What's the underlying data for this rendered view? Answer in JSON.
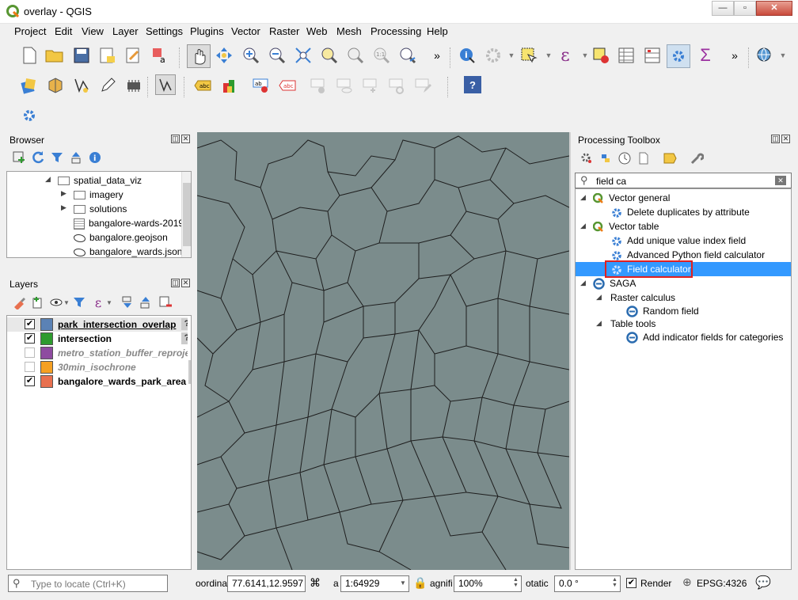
{
  "window": {
    "title": "overlay - QGIS",
    "min": "—",
    "max": "▫",
    "close": "✕"
  },
  "menus": [
    "Project",
    "Edit",
    "View",
    "Layer",
    "Settings",
    "Plugins",
    "Vector",
    "Raster",
    "Web",
    "Mesh",
    "Processing",
    "Help"
  ],
  "toolbar": {
    "more1": "»",
    "more2": "»",
    "help_icon": "?"
  },
  "browser": {
    "title": "Browser",
    "items": [
      {
        "label": "spatial_data_viz",
        "type": "folder"
      },
      {
        "label": "imagery",
        "type": "folder"
      },
      {
        "label": "solutions",
        "type": "folder"
      },
      {
        "label": "bangalore-wards-2019",
        "type": "file"
      },
      {
        "label": "bangalore.geojson",
        "type": "poly"
      },
      {
        "label": "bangalore_wards.json",
        "type": "poly"
      }
    ]
  },
  "layers": {
    "title": "Layers",
    "items": [
      {
        "name": "park_intersection_overlap",
        "color": "#5b82b5",
        "checked": true,
        "style": "bold-underline",
        "warn": "?"
      },
      {
        "name": "intersection",
        "color": "#2e9b2e",
        "checked": true,
        "style": "bold",
        "warn": "?"
      },
      {
        "name": "metro_station_buffer_reproje",
        "color": "#8e4ba0",
        "checked": false,
        "style": "italic"
      },
      {
        "name": "30min_isochrone",
        "color": "#f5a023",
        "checked": false,
        "style": "italic"
      },
      {
        "name": "bangalore_wards_park_area",
        "color": "#e8704f",
        "checked": true,
        "style": "bold"
      }
    ]
  },
  "toolbox": {
    "title": "Processing Toolbox",
    "search_value": "field ca",
    "tree": [
      {
        "label": "Vector general",
        "level": 0,
        "icon": "qgis"
      },
      {
        "label": "Delete duplicates by attribute",
        "level": 1,
        "icon": "gear"
      },
      {
        "label": "Vector table",
        "level": 0,
        "icon": "qgis"
      },
      {
        "label": "Add unique value index field",
        "level": 1,
        "icon": "gear"
      },
      {
        "label": "Advanced Python field calculator",
        "level": 1,
        "icon": "gear"
      },
      {
        "label": "Field calculator",
        "level": 1,
        "icon": "gear",
        "selected": true
      },
      {
        "label": "SAGA",
        "level": 0,
        "icon": "saga"
      },
      {
        "label": "Raster calculus",
        "level": 1,
        "icon": "none"
      },
      {
        "label": "Random field",
        "level": 2,
        "icon": "saga"
      },
      {
        "label": "Table tools",
        "level": 1,
        "icon": "none"
      },
      {
        "label": "Add indicator fields for categories",
        "level": 2,
        "icon": "saga"
      }
    ]
  },
  "status": {
    "locate_placeholder": "Type to locate (Ctrl+K)",
    "coord_label": "oordina",
    "coord_value": "77.6141,12.9597",
    "scale_label": "a",
    "scale_value": "1:64929",
    "magnifier_label": "agnifi",
    "magnifier_value": "100%",
    "rotation_label": "otatic",
    "rotation_value": "0.0 °",
    "render_label": "Render",
    "crs": "EPSG:4326"
  },
  "colors": {
    "map_fill": "#7b8c8c",
    "selection": "#3399ff",
    "highlight_box": "#e02020"
  }
}
